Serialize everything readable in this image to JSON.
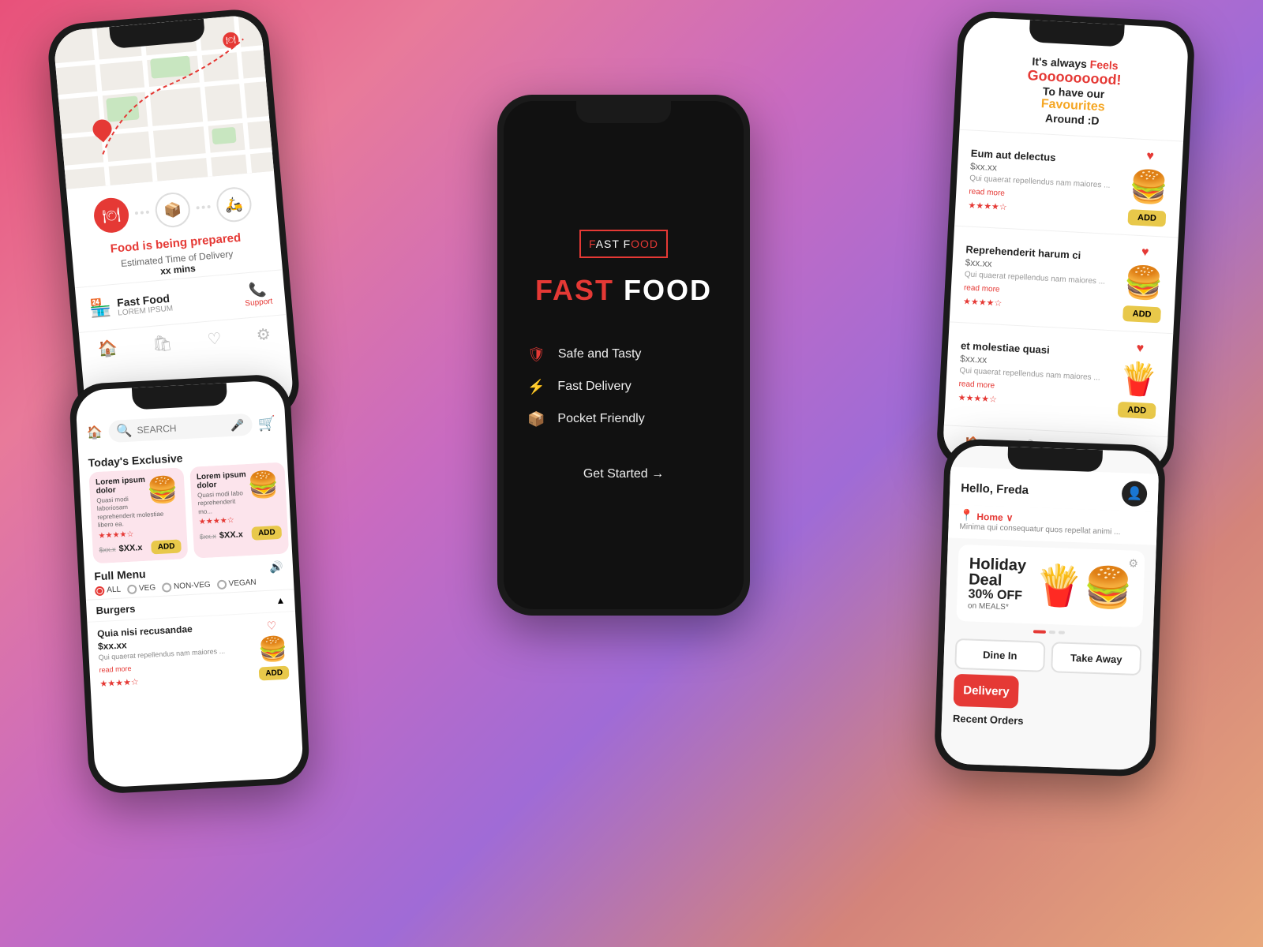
{
  "phone1": {
    "status": "Food is being prepared",
    "eta_label": "Estimated Time of Delivery",
    "eta_value": "xx mins",
    "restaurant_name": "Fast Food",
    "restaurant_sub": "LOREM IPSUM",
    "support_label": "Support",
    "nav_icons": [
      "home",
      "bag",
      "heart",
      "settings"
    ]
  },
  "phone2": {
    "logo_text": "FAST FOOD",
    "tagline_red": "FAST",
    "tagline_white": "FOOD",
    "features": [
      {
        "icon": "shield",
        "text": "Safe and Tasty"
      },
      {
        "icon": "lightning",
        "text": "Fast Delivery"
      },
      {
        "icon": "box",
        "text": "Pocket Friendly"
      }
    ],
    "cta": "Get Started →"
  },
  "phone3": {
    "search_placeholder": "SEARCH",
    "section_title": "Today's Exclusive",
    "cards": [
      {
        "title": "Lorem ipsum dolor",
        "desc": "Quasi modi laboriosam reprehenderit molestiae libero ea.",
        "stars": "★★★★☆",
        "old_price": "$xx.x",
        "new_price": "$XX.x",
        "add_label": "ADD"
      },
      {
        "title": "Lorem ipsum dolor",
        "desc": "Quasi modi labo reprehenderit mo...",
        "stars": "★★★★☆",
        "old_price": "$xx.x",
        "new_price": "$XX.x",
        "add_label": "ADD"
      }
    ],
    "full_menu_title": "Full Menu",
    "filters": [
      "ALL",
      "VEG",
      "NON-VEG",
      "VEGAN"
    ],
    "category": "Burgers",
    "menu_item": {
      "name": "Quia nisi recusandae",
      "price": "$xx.xx",
      "desc": "Qui quaerat repellendus nam maiores ...",
      "link": "read more"
    }
  },
  "phone4": {
    "promo": {
      "line1": "It's always Feels",
      "line2": "Gooooooood!",
      "line3": "To have our",
      "line4": "Favourites",
      "line5": "Around :D"
    },
    "items": [
      {
        "name": "Eum aut delectus",
        "price": "$xx.xx",
        "desc": "Qui quaerat repellendus nam maiores ...",
        "link": "read more",
        "stars": "★★★★☆"
      },
      {
        "name": "Reprehenderit harum ci",
        "price": "$xx.xx",
        "desc": "Qui quaerat repellendus nam maiores ...",
        "link": "read more",
        "stars": "★★★★☆"
      },
      {
        "name": "et molestiae quasi",
        "price": "$xx.xx",
        "desc": "Qui quaerat repellendus nam maiores ...",
        "link": "read more",
        "stars": "★★★★☆"
      }
    ],
    "add_label": "ADD",
    "nav_icons": [
      "home",
      "bag",
      "heart",
      "settings"
    ]
  },
  "phone5": {
    "greeting": "Hello, Freda",
    "location_label": "Home",
    "location_addr": "Minima qui consequatur quos repellat animi ...",
    "banner": {
      "title": "Holiday\nDeal",
      "off": "30% OFF",
      "sub": "on MEALS*"
    },
    "order_types": [
      "Dine In",
      "Take Away"
    ],
    "delivery_label": "Delivery",
    "recent_orders_label": "Recent Orders"
  }
}
